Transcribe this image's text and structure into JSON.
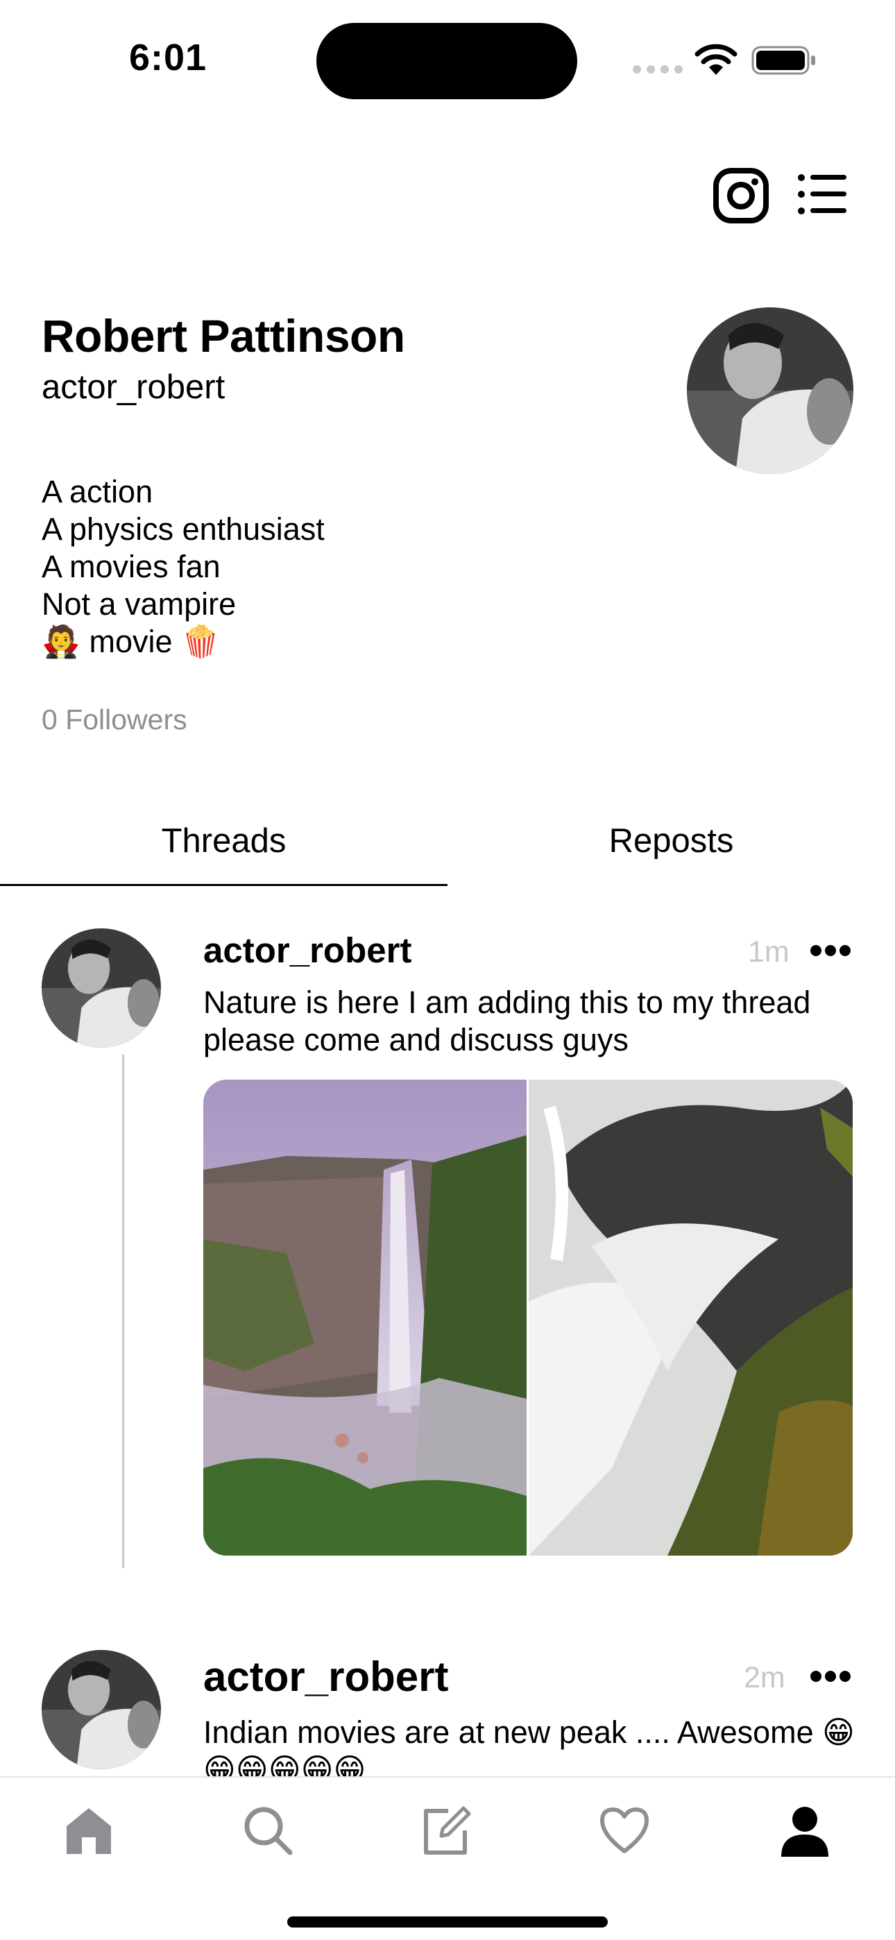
{
  "status_bar": {
    "time": "6:01"
  },
  "profile": {
    "name": "Robert Pattinson",
    "handle": "actor_robert",
    "bio": [
      "A action",
      "A physics enthusiast",
      "A movies fan",
      "Not a vampire",
      "🧛 movie 🍿"
    ],
    "followers": "0 Followers"
  },
  "tabs": [
    {
      "label": "Threads",
      "selected": true
    },
    {
      "label": "Reposts",
      "selected": false
    }
  ],
  "posts": [
    {
      "user": "actor_robert",
      "time": "1m",
      "text": "Nature is here I am adding this to my thread please come and discuss guys",
      "images": [
        "waterfall-cliff",
        "waterfall-rocks"
      ]
    },
    {
      "user": "actor_robert",
      "time": "2m",
      "text": "Indian movies are at new peak .... Awesome 😁😁😁😁😁😁"
    }
  ],
  "tab_bar": {
    "items": [
      "home-icon",
      "search-icon",
      "compose-icon",
      "heart-icon",
      "profile-icon"
    ],
    "active": "profile-icon"
  },
  "colors": {
    "accent": "#000000",
    "muted": "#8e8e93",
    "divider": "#c7c7cc"
  }
}
